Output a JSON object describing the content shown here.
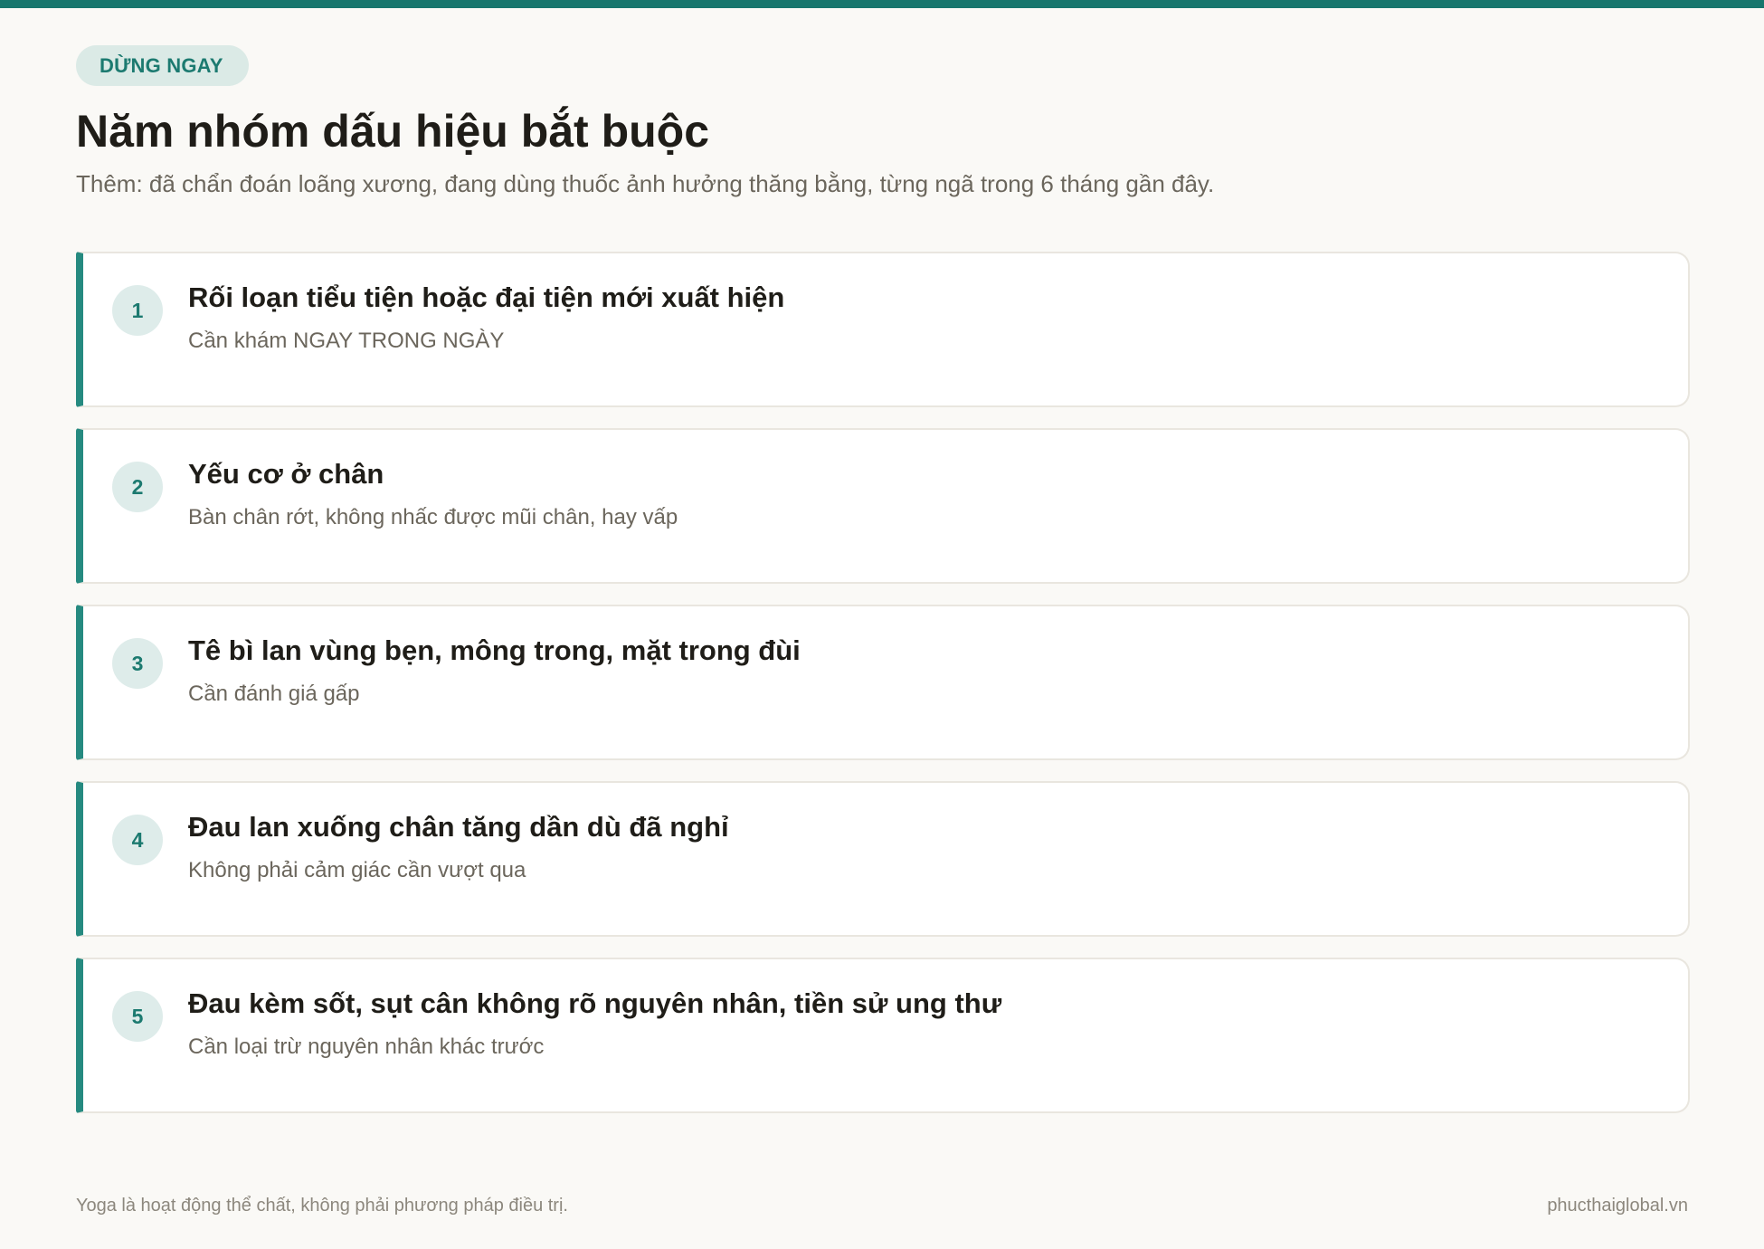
{
  "colors": {
    "accent": "#17766d",
    "badge_bg": "#dbeae6",
    "page_bg": "#faf9f6"
  },
  "badge": "DỪNG NGAY",
  "title": "Năm nhóm dấu hiệu bắt buộc",
  "subtitle": "Thêm: đã chẩn đoán loãng xương, đang dùng thuốc ảnh hưởng thăng bằng, từng ngã trong 6 tháng gần đây.",
  "items": [
    {
      "number": "1",
      "title": "Rối loạn tiểu tiện hoặc đại tiện mới xuất hiện",
      "desc": "Cần khám NGAY TRONG NGÀY"
    },
    {
      "number": "2",
      "title": "Yếu cơ ở chân",
      "desc": "Bàn chân rớt, không nhấc được mũi chân, hay vấp"
    },
    {
      "number": "3",
      "title": "Tê bì lan vùng bẹn, mông trong, mặt trong đùi",
      "desc": "Cần đánh giá gấp"
    },
    {
      "number": "4",
      "title": "Đau lan xuống chân tăng dần dù đã nghỉ",
      "desc": "Không phải cảm giác cần vượt qua"
    },
    {
      "number": "5",
      "title": "Đau kèm sốt, sụt cân không rõ nguyên nhân, tiền sử ung thư",
      "desc": "Cần loại trừ nguyên nhân khác trước"
    }
  ],
  "footer": {
    "disclaimer": "Yoga là hoạt động thể chất, không phải phương pháp điều trị.",
    "site": "phucthaiglobal.vn"
  }
}
